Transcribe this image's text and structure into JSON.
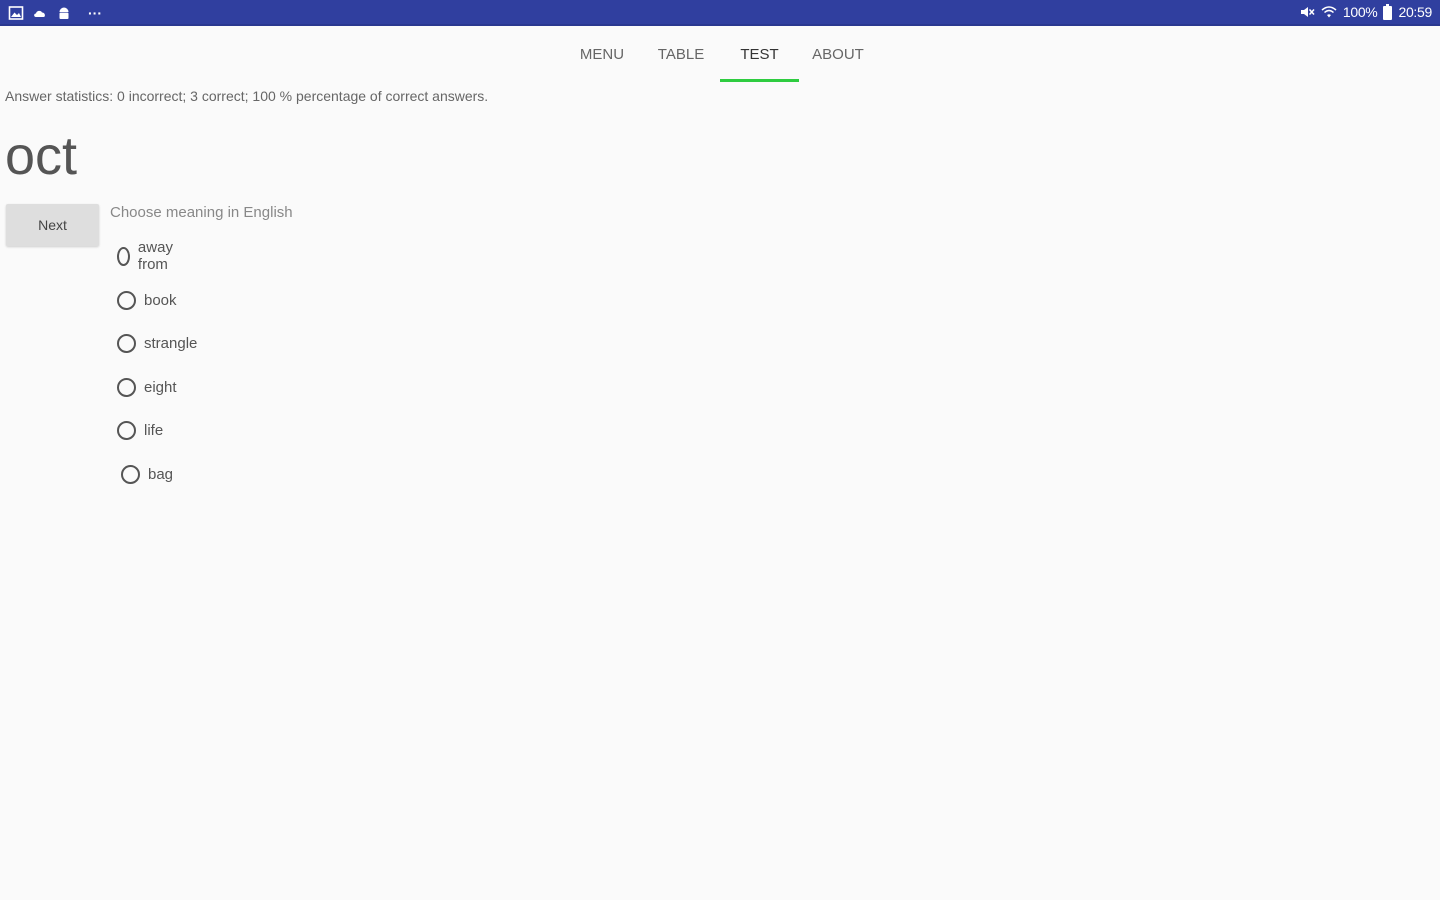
{
  "status_bar": {
    "left_icons": [
      "image-icon",
      "cloud-icon",
      "android-icon",
      "more-icon"
    ],
    "more_label": "···",
    "battery_text": "100%",
    "time": "20:59",
    "color": "#303f9f"
  },
  "tabs": [
    {
      "label": "MENU",
      "active": false
    },
    {
      "label": "TABLE",
      "active": false
    },
    {
      "label": "TEST",
      "active": true
    },
    {
      "label": "ABOUT",
      "active": false
    }
  ],
  "accent_color": "#2ecc40",
  "stats_text": "Answer statistics: 0 incorrect; 3 correct; 100 % percentage of correct answers.",
  "word": "oct",
  "next_label": "Next",
  "prompt": "Choose meaning in English",
  "options": [
    {
      "label": "away from",
      "checked": false
    },
    {
      "label": "book",
      "checked": false
    },
    {
      "label": "strangle",
      "checked": false
    },
    {
      "label": "eight",
      "checked": false
    },
    {
      "label": "life",
      "checked": false
    },
    {
      "label": "bag",
      "checked": false
    }
  ]
}
